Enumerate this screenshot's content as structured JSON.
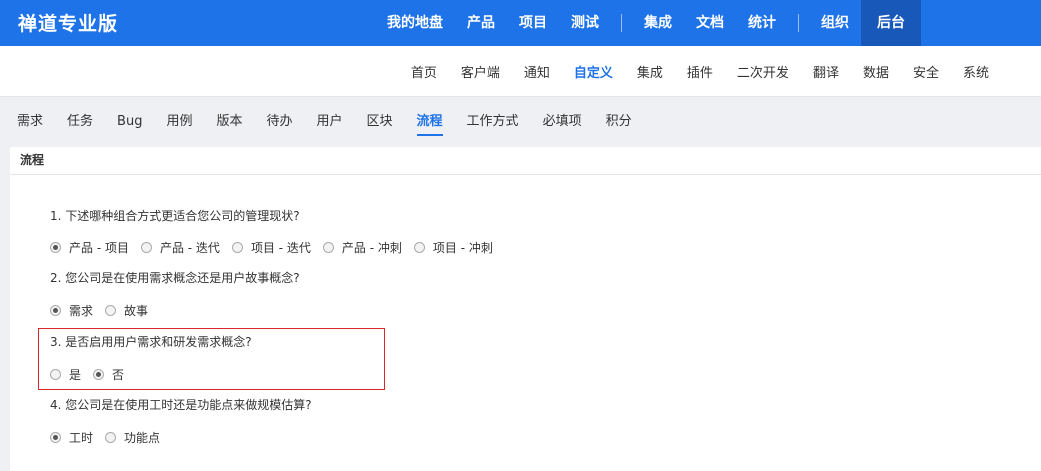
{
  "brand": "禅道专业版",
  "main_nav": [
    "我的地盘",
    "产品",
    "项目",
    "测试",
    "集成",
    "文档",
    "统计",
    "组织",
    "后台"
  ],
  "sub_nav": [
    "首页",
    "客户端",
    "通知",
    "自定义",
    "集成",
    "插件",
    "二次开发",
    "翻译",
    "数据",
    "安全",
    "系统"
  ],
  "module_tabs": [
    "需求",
    "任务",
    "Bug",
    "用例",
    "版本",
    "待办",
    "用户",
    "区块",
    "流程",
    "工作方式",
    "必填项",
    "积分"
  ],
  "panel_title": "流程",
  "questions": [
    {
      "text": "1. 下述哪种组合方式更适合您公司的管理现状?",
      "options": [
        "产品 - 项目",
        "产品 - 迭代",
        "项目 - 迭代",
        "产品 - 冲刺",
        "项目 - 冲刺"
      ],
      "selected": 0
    },
    {
      "text": "2. 您公司是在使用需求概念还是用户故事概念?",
      "options": [
        "需求",
        "故事"
      ],
      "selected": 0
    },
    {
      "text": "3. 是否启用用户需求和研发需求概念?",
      "options": [
        "是",
        "否"
      ],
      "selected": 1
    },
    {
      "text": "4. 您公司是在使用工时还是功能点来做规模估算?",
      "options": [
        "工时",
        "功能点"
      ],
      "selected": 0
    }
  ],
  "colors": {
    "header": "#1e73e8",
    "active_header": "#1758b8",
    "highlight_border": "#d9272e"
  }
}
